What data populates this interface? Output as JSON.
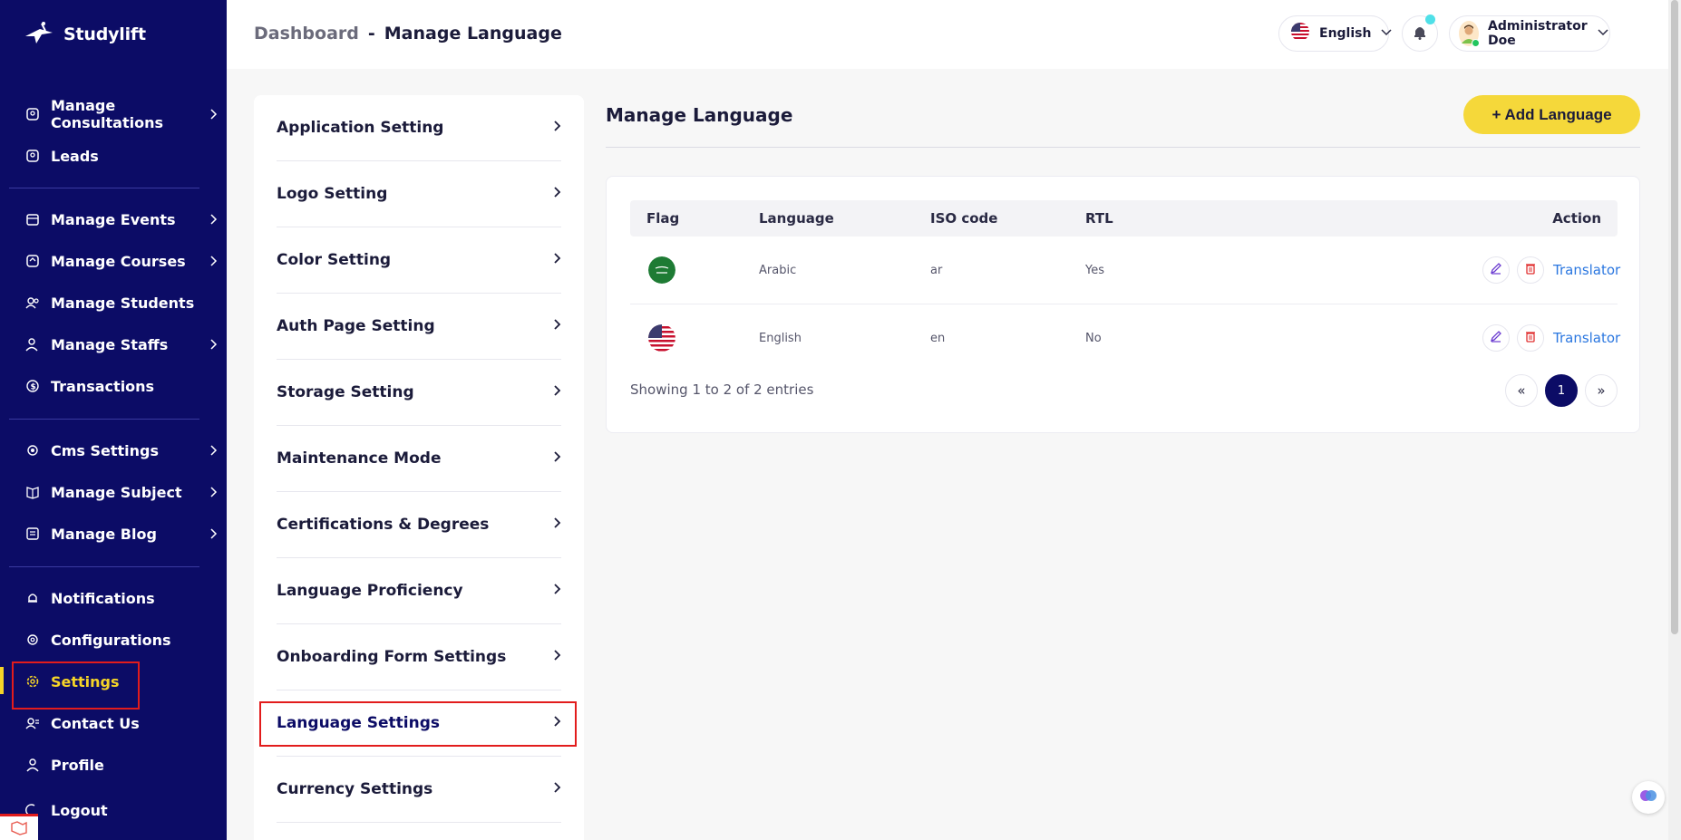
{
  "brand": {
    "name": "Studylift"
  },
  "colors": {
    "sidebar_bg": "#0c0c66",
    "accent": "#f5d428",
    "add_button": "#f5d83a",
    "link": "#2b77e0",
    "highlight": "#e21c1c"
  },
  "sidebar": {
    "items": [
      {
        "label": "Manage Consultations",
        "icon": "consultation-icon",
        "chevron": true
      },
      {
        "label": "Leads",
        "icon": "leads-icon",
        "chevron": false
      },
      {
        "label": "Manage Events",
        "icon": "calendar-icon",
        "chevron": true
      },
      {
        "label": "Manage Courses",
        "icon": "courses-icon",
        "chevron": true
      },
      {
        "label": "Manage Students",
        "icon": "students-icon",
        "chevron": false
      },
      {
        "label": "Manage Staffs",
        "icon": "staffs-icon",
        "chevron": true
      },
      {
        "label": "Transactions",
        "icon": "transactions-icon",
        "chevron": false
      },
      {
        "label": "Cms Settings",
        "icon": "cms-icon",
        "chevron": true
      },
      {
        "label": "Manage Subject",
        "icon": "book-icon",
        "chevron": true
      },
      {
        "label": "Manage Blog",
        "icon": "blog-icon",
        "chevron": true
      },
      {
        "label": "Notifications",
        "icon": "bell-icon",
        "chevron": false
      },
      {
        "label": "Configurations",
        "icon": "configurations-icon",
        "chevron": false
      },
      {
        "label": "Settings",
        "icon": "gear-icon",
        "chevron": false,
        "active": true
      },
      {
        "label": "Contact Us",
        "icon": "contact-icon",
        "chevron": false
      },
      {
        "label": "Profile",
        "icon": "user-icon",
        "chevron": false
      },
      {
        "label": "Logout",
        "icon": "logout-icon",
        "chevron": false
      }
    ]
  },
  "header": {
    "breadcrumb": {
      "parent": "Dashboard",
      "separator": "-",
      "current": "Manage Language"
    },
    "language": {
      "label": "English",
      "flag": "us-flag-icon"
    },
    "user": {
      "name": "Administrator Doe"
    }
  },
  "settings_menu": {
    "items": [
      "Application Setting",
      "Logo Setting",
      "Color Setting",
      "Auth Page Setting",
      "Storage Setting",
      "Maintenance Mode",
      "Certifications & Degrees",
      "Language Proficiency",
      "Onboarding Form Settings",
      "Language Settings",
      "Currency Settings"
    ],
    "active": "Language Settings"
  },
  "main": {
    "title": "Manage Language",
    "add_button": "+ Add Language",
    "table": {
      "headers": {
        "flag": "Flag",
        "language": "Language",
        "iso": "ISO code",
        "rtl": "RTL",
        "action": "Action"
      },
      "rows": [
        {
          "flag": "saudi-flag-icon",
          "language": "Arabic",
          "iso": "ar",
          "rtl": "Yes",
          "action_link": "Translator"
        },
        {
          "flag": "us-flag-icon",
          "language": "English",
          "iso": "en",
          "rtl": "No",
          "action_link": "Translator"
        }
      ]
    },
    "footer": {
      "showing": "Showing 1 to 2 of 2 entries",
      "pagination": {
        "prev": "«",
        "current": "1",
        "next": "»"
      }
    }
  }
}
